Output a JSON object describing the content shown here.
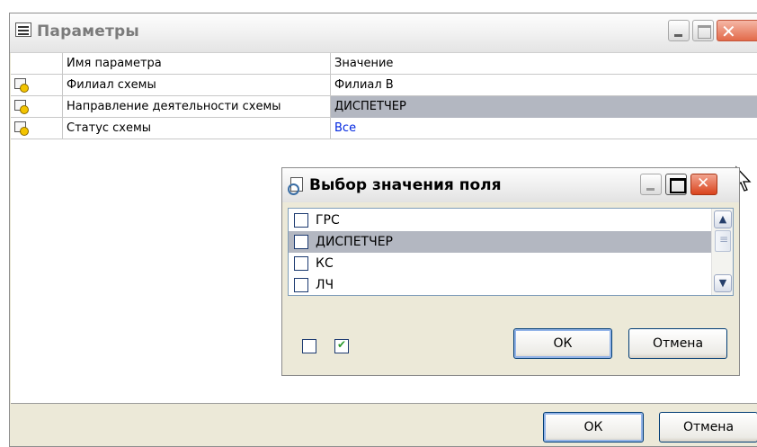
{
  "window": {
    "title": "Параметры"
  },
  "grid": {
    "headers": [
      "",
      "Имя параметра",
      "Значение"
    ],
    "rows": [
      {
        "name": "Филиал схемы",
        "value": "Филиал В"
      },
      {
        "name": "Направление деятельности схемы",
        "value": "ДИСПЕТЧЕР"
      },
      {
        "name": "Статус схемы",
        "value": "Все"
      }
    ]
  },
  "buttons": {
    "ok": "ОК",
    "cancel": "Отмена"
  },
  "popup": {
    "title": "Выбор значения поля",
    "items": [
      {
        "label": "ГРС",
        "checked": false
      },
      {
        "label": "ДИСПЕТЧЕР",
        "checked": false
      },
      {
        "label": "КС",
        "checked": false
      },
      {
        "label": "ЛЧ",
        "checked": false
      }
    ],
    "ok": "ОК",
    "cancel": "Отмена"
  },
  "icons": {
    "window": "list-window-icon",
    "param": "key-parameter-icon",
    "popup": "magnifier-document-icon",
    "cursor": "mouse-pointer-icon"
  }
}
